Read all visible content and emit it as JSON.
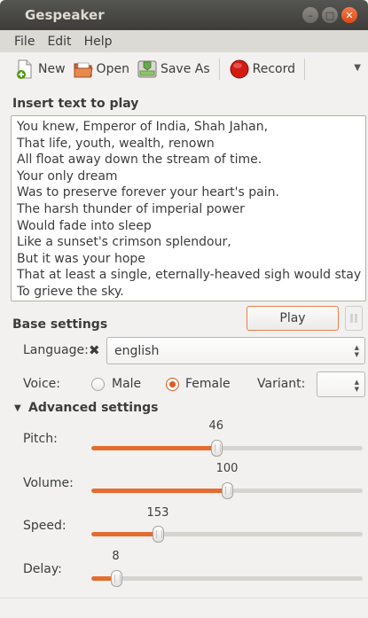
{
  "window": {
    "title": "Gespeaker"
  },
  "menu": {
    "items": [
      "File",
      "Edit",
      "Help"
    ]
  },
  "toolbar": {
    "new_label": "New",
    "open_label": "Open",
    "saveas_label": "Save As",
    "record_label": "Record"
  },
  "text_section": {
    "label": "Insert text to play",
    "lines": [
      "You knew, Emperor of India, Shah Jahan,",
      "That life, youth, wealth, renown",
      "All float away down the stream of time.",
      "Your only dream",
      "Was to preserve forever your heart's pain.",
      "The harsh thunder of imperial power",
      "Would fade into sleep",
      "Like a sunset's crimson splendour,",
      "But it was your hope",
      "That at least a single, eternally-heaved sigh would stay",
      "To grieve the sky."
    ]
  },
  "base": {
    "label": "Base settings",
    "play_label": "Play",
    "language_label": "Language:",
    "language_value": "english",
    "voice_label": "Voice:",
    "male_label": "Male",
    "female_label": "Female",
    "voice_selected": "Female",
    "variant_label": "Variant:"
  },
  "advanced": {
    "label": "Advanced settings",
    "sliders": [
      {
        "label": "Pitch:",
        "value": "46",
        "fraction": 0.46
      },
      {
        "label": "Volume:",
        "value": "100",
        "fraction": 0.5
      },
      {
        "label": "Speed:",
        "value": "153",
        "fraction": 0.245
      },
      {
        "label": "Delay:",
        "value": "8",
        "fraction": 0.09
      }
    ]
  },
  "colors": {
    "accent": "#e36d2f",
    "titlebar": "#3e3d39",
    "window_bg": "#f2f1f0"
  }
}
